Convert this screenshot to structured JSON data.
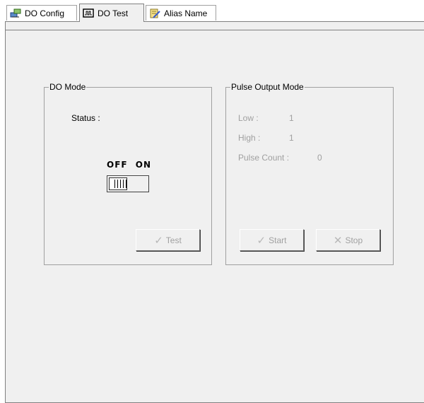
{
  "tabs": [
    {
      "label": "DO Config",
      "icon": "network-config-icon"
    },
    {
      "label": "DO Test",
      "icon": "test-monitor-icon",
      "active": true
    },
    {
      "label": "Alias Name",
      "icon": "edit-notepad-icon"
    }
  ],
  "do_mode": {
    "title": "DO Mode",
    "status_label": "Status :",
    "off_label": "OFF",
    "on_label": "ON",
    "switch_state": "OFF",
    "test_button": "Test"
  },
  "pulse_output": {
    "title": "Pulse Output Mode",
    "low_label": "Low :",
    "low_value": "1",
    "high_label": "High :",
    "high_value": "1",
    "pulse_count_label": "Pulse Count :",
    "pulse_count_value": "0",
    "start_button": "Start",
    "stop_button": "Stop"
  },
  "colors": {
    "panel_bg": "#f0f0f0",
    "disabled_text": "#a0a0a0"
  }
}
